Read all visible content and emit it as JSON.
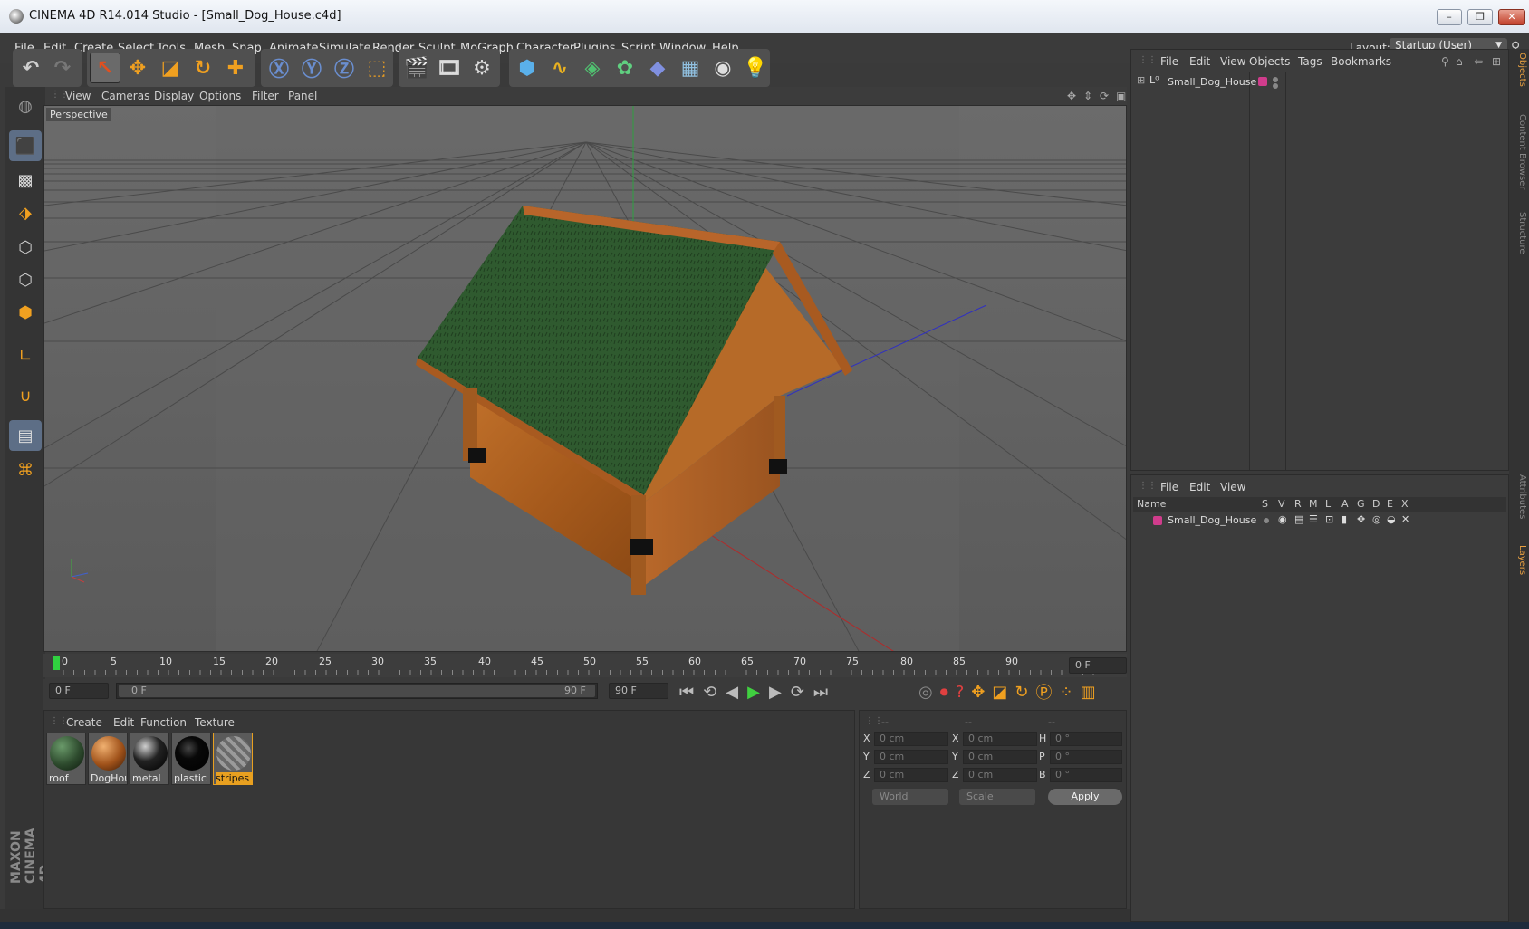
{
  "window": {
    "title": "CINEMA 4D R14.014 Studio - [Small_Dog_House.c4d]",
    "minimize": "–",
    "restore": "❐",
    "close": "✕"
  },
  "menu": [
    "File",
    "Edit",
    "Create",
    "Select",
    "Tools",
    "Mesh",
    "Snap",
    "Animate",
    "Simulate",
    "Render",
    "Sculpt",
    "MoGraph",
    "Character",
    "Plugins",
    "Script",
    "Window",
    "Help"
  ],
  "layout": {
    "label": "Layout:",
    "value": "Startup (User)"
  },
  "viewport": {
    "menu": [
      "View",
      "Cameras",
      "Display",
      "Options",
      "Filter",
      "Panel"
    ],
    "label": "Perspective"
  },
  "timeline": {
    "ticks": [
      "0",
      "5",
      "10",
      "15",
      "20",
      "25",
      "30",
      "35",
      "40",
      "45",
      "50",
      "55",
      "60",
      "65",
      "70",
      "75",
      "80",
      "85",
      "90"
    ],
    "frame_field": "0 F",
    "start_field": "0 F",
    "range_start": "0 F",
    "range_end": "90 F",
    "end_field": "90 F"
  },
  "materials": {
    "menu": [
      "Create",
      "Edit",
      "Function",
      "Texture"
    ],
    "items": [
      {
        "label": "roof",
        "color": "#2d4a2d"
      },
      {
        "label": "DogHou",
        "color": "#a0521a"
      },
      {
        "label": "metal",
        "color": "#222222"
      },
      {
        "label": "plastic",
        "color": "#080808"
      },
      {
        "label": "stripes",
        "color": "#7a7a7a"
      }
    ]
  },
  "coords": {
    "headers": [
      "--",
      "--",
      "--"
    ],
    "rows": [
      {
        "l1": "X",
        "v1": "0 cm",
        "l2": "X",
        "v2": "0 cm",
        "l3": "H",
        "v3": "0 °"
      },
      {
        "l1": "Y",
        "v1": "0 cm",
        "l2": "Y",
        "v2": "0 cm",
        "l3": "P",
        "v3": "0 °"
      },
      {
        "l1": "Z",
        "v1": "0 cm",
        "l2": "Z",
        "v2": "0 cm",
        "l3": "B",
        "v3": "0 °"
      }
    ],
    "world": "World",
    "scale": "Scale",
    "apply": "Apply"
  },
  "objects": {
    "menu": [
      "File",
      "Edit",
      "View",
      "Objects",
      "Tags",
      "Bookmarks"
    ],
    "item": "Small_Dog_House"
  },
  "layers": {
    "menu": [
      "File",
      "Edit",
      "View"
    ],
    "columns": [
      "Name",
      "S",
      "V",
      "R",
      "M",
      "L",
      "A",
      "G",
      "D",
      "E",
      "X"
    ],
    "item": "Small_Dog_House"
  },
  "rail_tabs": [
    "Objects",
    "Content Browser",
    "Structure",
    "Attributes",
    "Layers"
  ],
  "brand": "MAXON CINEMA 4D"
}
